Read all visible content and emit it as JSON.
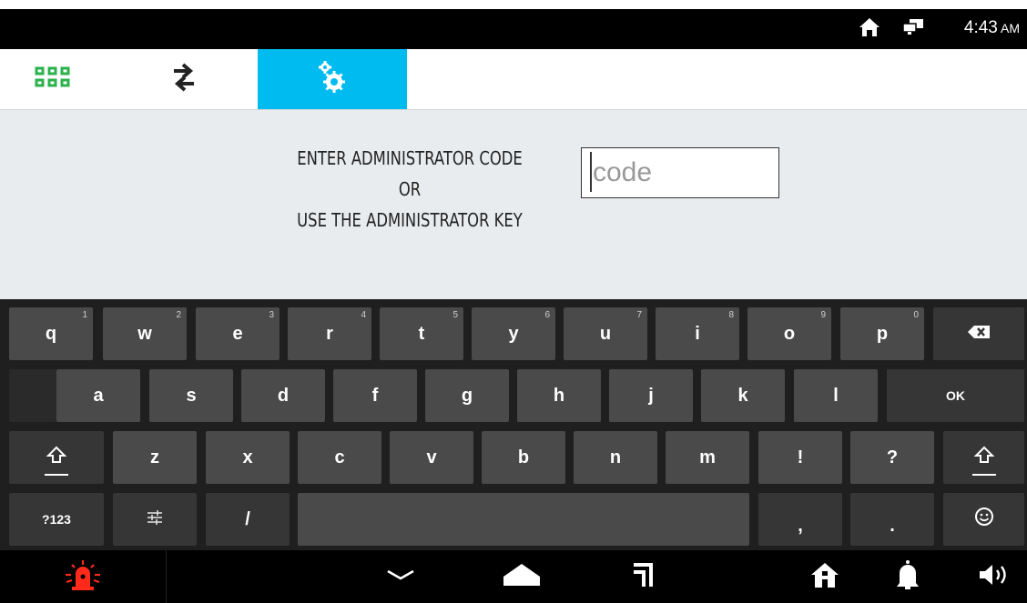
{
  "status_bar": {
    "time": "4:43",
    "ampm": "AM",
    "icons": [
      "home-icon",
      "remote-desktop-icon"
    ]
  },
  "tabs": [
    {
      "name": "apps",
      "icon": "grid-icon"
    },
    {
      "name": "transfer",
      "icon": "swap-arrows-icon"
    },
    {
      "name": "settings",
      "icon": "gears-icon",
      "active": true
    }
  ],
  "prompt": {
    "line1": "ENTER ADMINISTRATOR CODE",
    "line2": "OR",
    "line3": "USE THE ADMINISTRATOR KEY"
  },
  "code_input": {
    "placeholder": "code",
    "value": ""
  },
  "keyboard": {
    "row1": [
      {
        "label": "q",
        "hint": "1"
      },
      {
        "label": "w",
        "hint": "2"
      },
      {
        "label": "e",
        "hint": "3"
      },
      {
        "label": "r",
        "hint": "4"
      },
      {
        "label": "t",
        "hint": "5"
      },
      {
        "label": "y",
        "hint": "6"
      },
      {
        "label": "u",
        "hint": "7"
      },
      {
        "label": "i",
        "hint": "8"
      },
      {
        "label": "o",
        "hint": "9"
      },
      {
        "label": "p",
        "hint": "0"
      }
    ],
    "row2": [
      "a",
      "s",
      "d",
      "f",
      "g",
      "h",
      "j",
      "k",
      "l"
    ],
    "row3": [
      "z",
      "x",
      "c",
      "v",
      "b",
      "n",
      "m",
      "!",
      "?"
    ],
    "ok_label": "OK",
    "symbols_label": "?123",
    "slash_label": "/",
    "comma_label": ",",
    "period_label": ".",
    "backspace_icon": "backspace-icon",
    "shift_icon": "shift-icon",
    "settings_icon": "keyboard-settings-icon",
    "emoji_icon": "emoji-icon"
  },
  "navbar": {
    "icons": [
      "alarm-icon",
      "back-icon",
      "home-icon",
      "recents-icon",
      "home-icon",
      "bell-icon",
      "volume-icon"
    ],
    "alarm_color": "#ff2a1a"
  },
  "colors": {
    "accent": "#00bbf0",
    "grid_green": "#2bb24c"
  }
}
